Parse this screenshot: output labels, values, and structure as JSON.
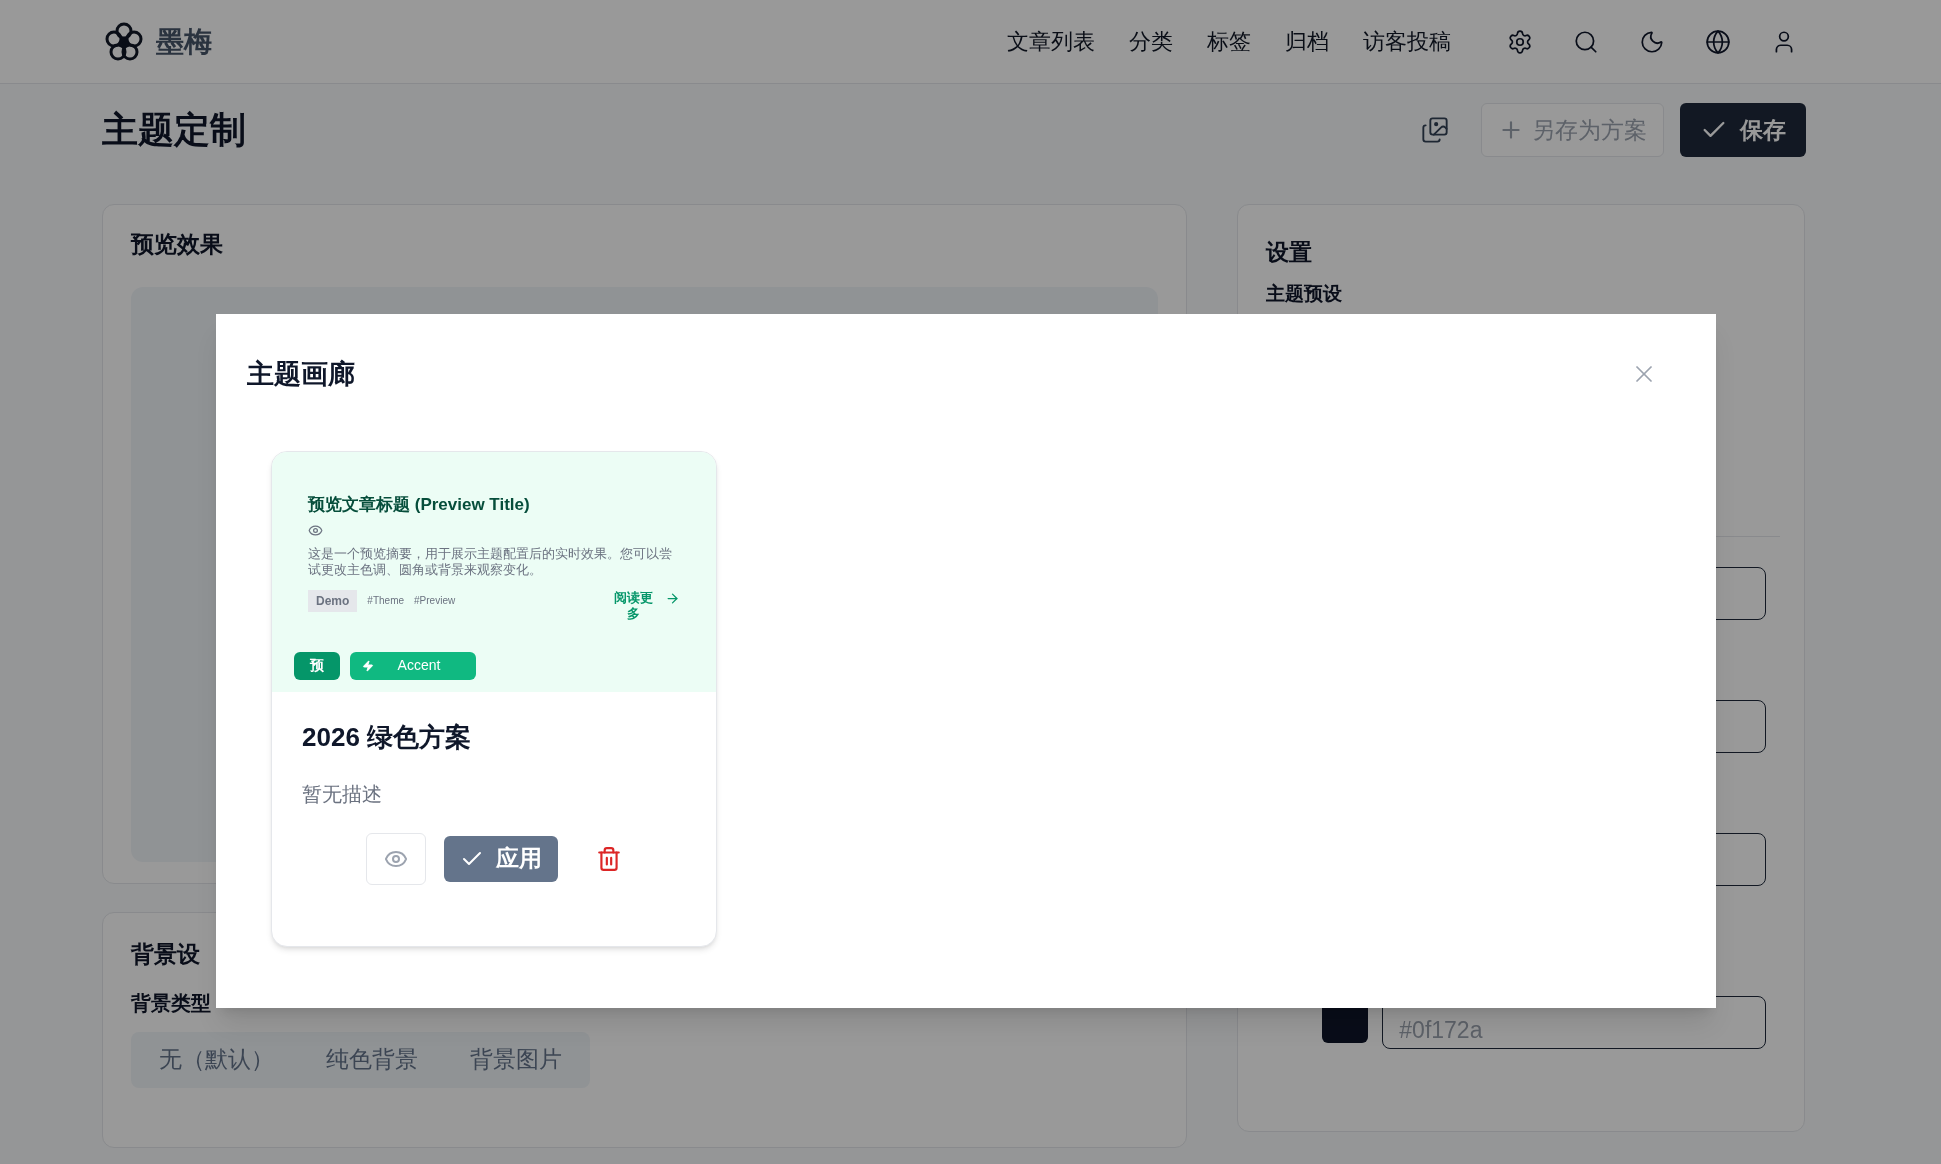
{
  "header": {
    "logo_text": "墨梅",
    "nav": [
      "文章列表",
      "分类",
      "标签",
      "归档",
      "访客投稿"
    ]
  },
  "page": {
    "title": "主题定制",
    "save_as_button": "另存为方案",
    "save_button": "保存"
  },
  "preview_panel": {
    "title": "预览效果"
  },
  "background_panel": {
    "title": "背景设",
    "type_label": "背景类型",
    "type_options": [
      "无（默认）",
      "纯色背景",
      "背景图片"
    ]
  },
  "settings_panel": {
    "title": "设置",
    "preset_label": "主题预设",
    "color_value": "#0f172a"
  },
  "dialog": {
    "title": "主题画廊",
    "themes": [
      {
        "preview": {
          "title": "预览文章标题 (Preview Title)",
          "summary": "这是一个预览摘要，用于展示主题配置后的实时效果。您可以尝试更改主色调、圆角或背景来观察变化。",
          "category": "Demo",
          "tags": [
            "#Theme",
            "#Preview"
          ],
          "read_more": "阅读更多",
          "primary_button": "预",
          "accent_button": "Accent"
        },
        "name": "2026 绿色方案",
        "description": "暂无描述",
        "apply_button": "应用"
      }
    ]
  }
}
